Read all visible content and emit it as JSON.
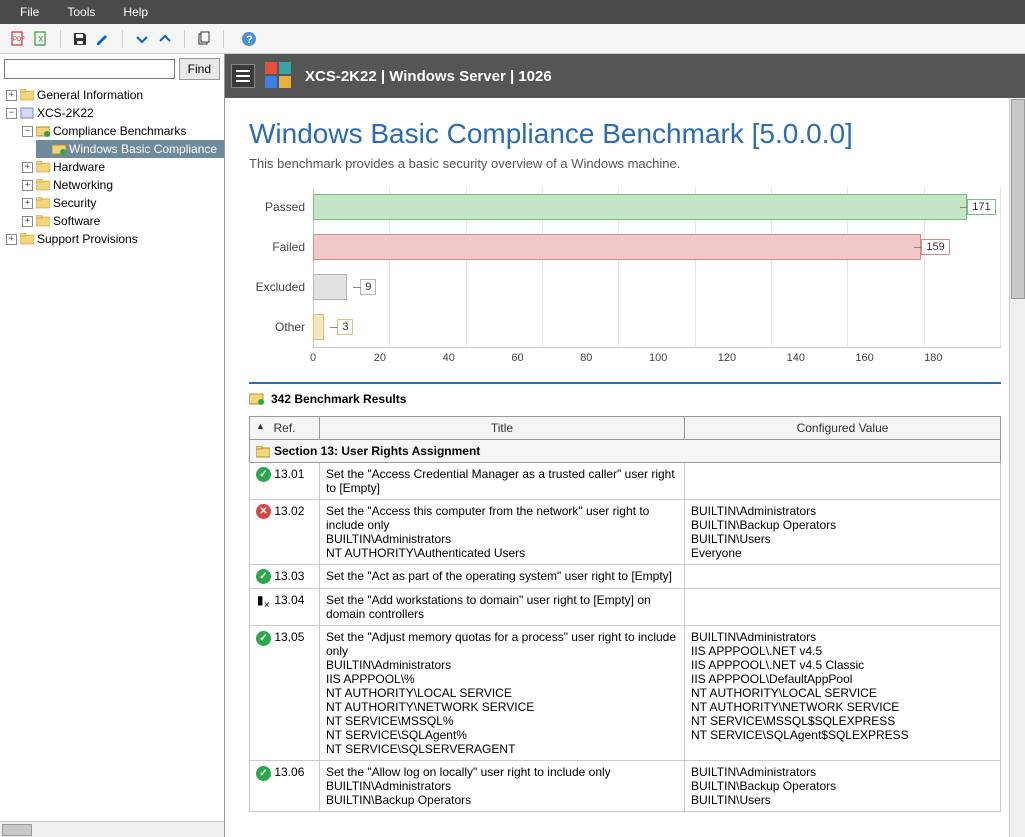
{
  "menu": {
    "file": "File",
    "tools": "Tools",
    "help": "Help"
  },
  "sidebar": {
    "find_label": "Find",
    "search_placeholder": "",
    "tree": {
      "general_info": "General Information",
      "host": "XCS-2K22",
      "compliance_benchmarks": "Compliance Benchmarks",
      "win_basic": "Windows Basic Compliance",
      "hardware": "Hardware",
      "networking": "Networking",
      "security": "Security",
      "software": "Software",
      "support_provisions": "Support Provisions"
    }
  },
  "header": {
    "breadcrumb": "XCS-2K22 | Windows Server | 1026"
  },
  "page": {
    "title": "Windows Basic Compliance Benchmark [5.0.0.0]",
    "subtitle": "This benchmark provides a basic security overview of a Windows machine."
  },
  "chart_data": {
    "type": "bar",
    "categories": [
      "Passed",
      "Failed",
      "Excluded",
      "Other"
    ],
    "values": [
      171,
      159,
      9,
      3
    ],
    "xlim": [
      0,
      180
    ],
    "ticks": [
      0,
      20,
      40,
      60,
      80,
      100,
      120,
      140,
      160,
      180
    ],
    "colors": {
      "Passed": "#c4e6c4",
      "Failed": "#f1c9c9",
      "Excluded": "#e2e2e2",
      "Other": "#f5e6bd"
    }
  },
  "results": {
    "count_label": "342 Benchmark Results",
    "columns": {
      "ref": "Ref.",
      "title": "Title",
      "value": "Configured Value"
    },
    "section": "Section 13: User Rights Assignment",
    "rows": [
      {
        "ref": "13.01",
        "status": "pass",
        "title": "Set the \"Access Credential Manager as a trusted caller\" user right to [Empty]",
        "value": ""
      },
      {
        "ref": "13.02",
        "status": "fail",
        "title": "Set the \"Access this computer from the network\" user right to include only\nBUILTIN\\Administrators\nNT AUTHORITY\\Authenticated Users",
        "value": "BUILTIN\\Administrators\nBUILTIN\\Backup Operators\nBUILTIN\\Users\nEveryone"
      },
      {
        "ref": "13.03",
        "status": "pass",
        "title": "Set the \"Act as part of the operating system\" user right to [Empty]",
        "value": ""
      },
      {
        "ref": "13.04",
        "status": "na",
        "title": "Set the \"Add workstations to domain\" user right to [Empty] on domain controllers",
        "value": ""
      },
      {
        "ref": "13.05",
        "status": "pass",
        "title": "Set the \"Adjust memory quotas for a process\" user right to include only\nBUILTIN\\Administrators\nIIS APPPOOL\\%\nNT AUTHORITY\\LOCAL SERVICE\nNT AUTHORITY\\NETWORK SERVICE\nNT SERVICE\\MSSQL%\nNT SERVICE\\SQLAgent%\nNT SERVICE\\SQLSERVERAGENT",
        "value": "BUILTIN\\Administrators\nIIS APPPOOL\\.NET v4.5\nIIS APPPOOL\\.NET v4.5 Classic\nIIS APPPOOL\\DefaultAppPool\nNT AUTHORITY\\LOCAL SERVICE\nNT AUTHORITY\\NETWORK SERVICE\nNT SERVICE\\MSSQL$SQLEXPRESS\nNT SERVICE\\SQLAgent$SQLEXPRESS"
      },
      {
        "ref": "13.06",
        "status": "pass",
        "title": "Set the \"Allow log on locally\" user right to include only\nBUILTIN\\Administrators\nBUILTIN\\Backup Operators",
        "value": "BUILTIN\\Administrators\nBUILTIN\\Backup Operators\nBUILTIN\\Users"
      }
    ]
  }
}
